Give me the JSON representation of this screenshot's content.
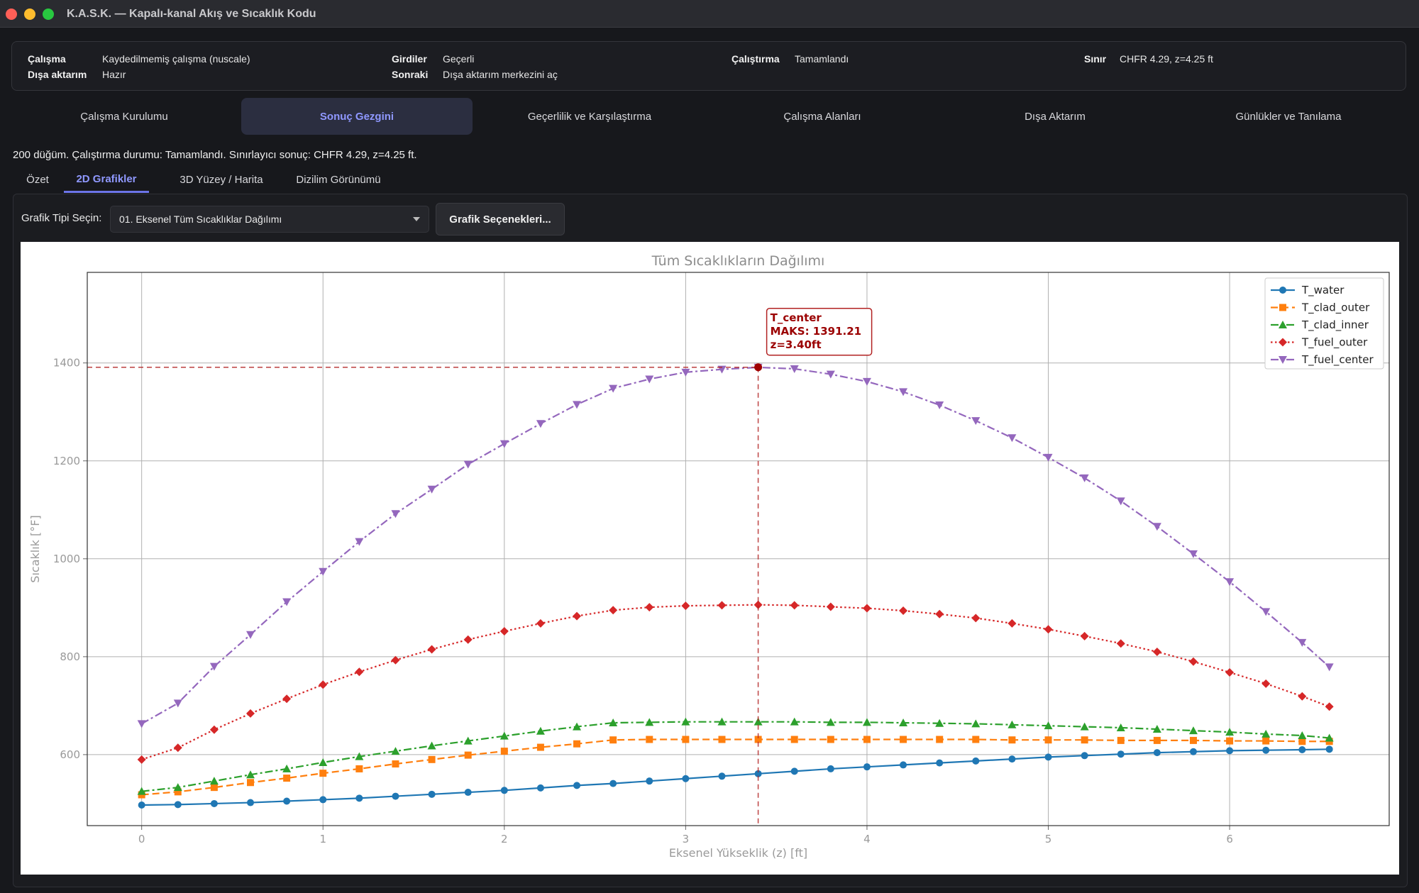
{
  "window": {
    "title": "K.A.S.K. — Kapalı-kanal Akış ve Sıcaklık Kodu"
  },
  "info": {
    "calisma_label": "Çalışma",
    "calisma_value": "Kaydedilmemiş çalışma (nuscale)",
    "disa_label": "Dışa aktarım",
    "disa_value": "Hazır",
    "girdiler_label": "Girdiler",
    "girdiler_value": "Geçerli",
    "sonraki_label": "Sonraki",
    "sonraki_value": "Dışa aktarım merkezini aç",
    "calistirma_label": "Çalıştırma",
    "calistirma_value": "Tamamlandı",
    "sinir_label": "Sınır",
    "sinir_value": "CHFR 4.29, z=4.25  ft"
  },
  "main_tabs": [
    {
      "label": "Çalışma Kurulumu"
    },
    {
      "label": "Sonuç Gezgini"
    },
    {
      "label": "Geçerlilik ve Karşılaştırma"
    },
    {
      "label": "Çalışma Alanları"
    },
    {
      "label": "Dışa Aktarım"
    },
    {
      "label": "Günlükler ve Tanılama"
    }
  ],
  "active_main_tab": 1,
  "status_text": "200 düğüm. Çalıştırma durumu: Tamamlandı. Sınırlayıcı sonuç: CHFR 4.29, z=4.25  ft.",
  "sub_tabs": [
    {
      "label": "Özet"
    },
    {
      "label": "2D Grafikler"
    },
    {
      "label": "3D Yüzey / Harita"
    },
    {
      "label": "Dizilim Görünümü"
    }
  ],
  "active_sub_tab": 1,
  "plot_controls": {
    "type_label": "Grafik Tipi Seçin:",
    "selected_type": "01. Eksenel Tüm Sıcaklıklar Dağılımı",
    "options_button": "Grafik Seçenekleri..."
  },
  "colors": {
    "T_water": "#1f77b4",
    "T_clad_outer": "#ff7f0e",
    "T_clad_inner": "#2ca02c",
    "T_fuel_outer": "#d62728",
    "T_fuel_center": "#9467bd",
    "annotation": "#b22222"
  },
  "chart_data": {
    "type": "line",
    "title": "Tüm Sıcaklıkların Dağılımı",
    "xlabel": "Eksenel Yükseklik (z) [ft]",
    "ylabel": "Sıcaklık [°F]",
    "xlim": [
      -0.3,
      6.88
    ],
    "ylim": [
      455,
      1585
    ],
    "xticks": [
      0,
      1,
      2,
      3,
      4,
      5,
      6
    ],
    "yticks": [
      600,
      800,
      1000,
      1200,
      1400
    ],
    "grid": true,
    "legend_position": "top-right",
    "x": [
      0,
      0.2,
      0.4,
      0.6,
      0.8,
      1.0,
      1.2,
      1.4,
      1.6,
      1.8,
      2.0,
      2.2,
      2.4,
      2.6,
      2.8,
      3.0,
      3.2,
      3.4,
      3.6,
      3.8,
      4.0,
      4.2,
      4.4,
      4.6,
      4.8,
      5.0,
      5.2,
      5.4,
      5.6,
      5.8,
      6.0,
      6.2,
      6.4,
      6.55
    ],
    "series": [
      {
        "name": "T_water",
        "marker": "circle",
        "dash": "solid",
        "values": [
          497,
          498,
          500,
          502,
          505,
          508,
          511,
          515,
          519,
          523,
          527,
          532,
          537,
          541,
          546,
          551,
          556,
          561,
          566,
          571,
          575,
          579,
          583,
          587,
          591,
          595,
          598,
          601,
          604,
          606,
          608,
          609,
          610,
          611
        ]
      },
      {
        "name": "T_clad_outer",
        "marker": "square",
        "dash": "dashed",
        "values": [
          518,
          524,
          533,
          543,
          552,
          562,
          571,
          581,
          590,
          599,
          607,
          615,
          622,
          630,
          631,
          631,
          631,
          631,
          631,
          631,
          631,
          631,
          631,
          631,
          630,
          630,
          630,
          629,
          629,
          629,
          628,
          628,
          627,
          627
        ]
      },
      {
        "name": "T_clad_inner",
        "marker": "triangle-up",
        "dash": "dashdot",
        "values": [
          525,
          533,
          546,
          559,
          571,
          584,
          596,
          607,
          618,
          628,
          638,
          648,
          657,
          665,
          666,
          667,
          667,
          667,
          667,
          666,
          666,
          665,
          664,
          663,
          661,
          659,
          657,
          655,
          652,
          649,
          646,
          642,
          639,
          634
        ]
      },
      {
        "name": "T_fuel_outer",
        "marker": "diamond",
        "dash": "dotted",
        "values": [
          590,
          614,
          651,
          684,
          714,
          743,
          769,
          793,
          815,
          835,
          852,
          868,
          883,
          895,
          901,
          904,
          905,
          906,
          905,
          902,
          899,
          894,
          887,
          879,
          868,
          856,
          842,
          827,
          810,
          790,
          768,
          745,
          719,
          698
        ]
      },
      {
        "name": "T_fuel_center",
        "marker": "triangle-down",
        "dash": "dashdot",
        "values": [
          663,
          705,
          780,
          845,
          912,
          974,
          1035,
          1092,
          1142,
          1193,
          1235,
          1276,
          1315,
          1348,
          1367,
          1381,
          1387,
          1391,
          1388,
          1377,
          1362,
          1341,
          1314,
          1282,
          1247,
          1207,
          1165,
          1118,
          1066,
          1010,
          953,
          892,
          829,
          779
        ]
      }
    ],
    "annotation": {
      "lines": [
        "T_center",
        "MAKS: 1391.21",
        "z=3.40ft"
      ],
      "x": 3.4,
      "y": 1391.21
    }
  }
}
